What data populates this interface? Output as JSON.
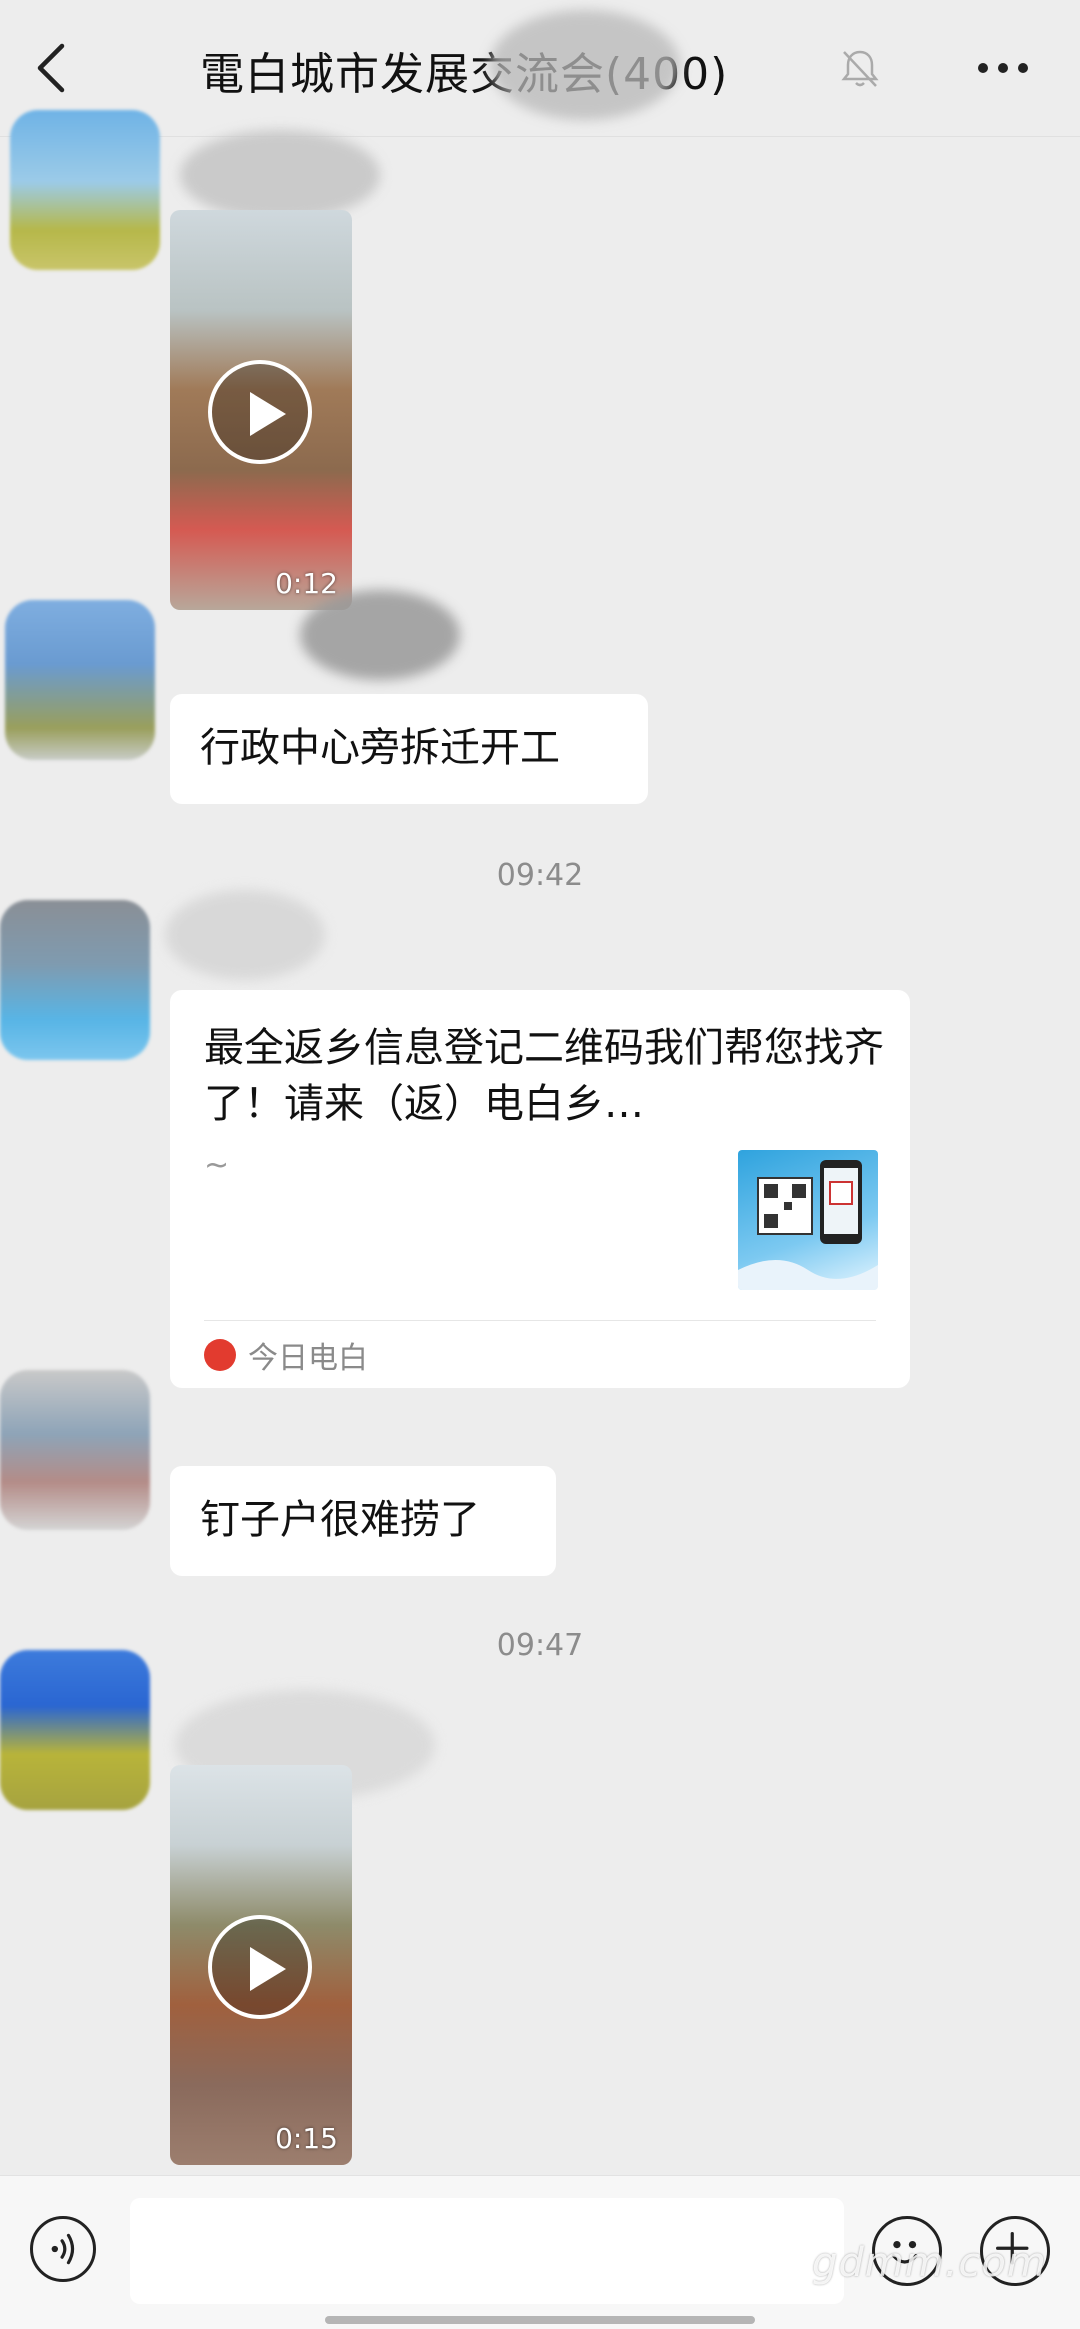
{
  "header": {
    "title": "電白城市发展交流会(400)",
    "back_icon": "chevron-left-icon",
    "mute_icon": "bell-off-icon",
    "more_icon": "more-horizontal-icon"
  },
  "messages": [
    {
      "type": "video",
      "duration": "0:12"
    },
    {
      "type": "text",
      "text": "行政中心旁拆迁开工"
    },
    {
      "type": "timestamp",
      "text": "09:42"
    },
    {
      "type": "share_card",
      "title": "最全返乡信息登记二维码我们帮您找齐了！请来（返）电白乡…",
      "desc": "~",
      "source": "今日电白"
    },
    {
      "type": "text",
      "text": "钉子户很难捞了"
    },
    {
      "type": "timestamp",
      "text": "09:47"
    },
    {
      "type": "video",
      "duration": "0:15"
    }
  ],
  "input_bar": {
    "voice_icon": "voice-icon",
    "emoji_icon": "emoji-icon",
    "plus_icon": "plus-icon",
    "placeholder": ""
  },
  "watermark": "gdmm.com",
  "colors": {
    "background": "#ededed",
    "bubble": "#ffffff",
    "timestamp": "#8c8c8c"
  }
}
